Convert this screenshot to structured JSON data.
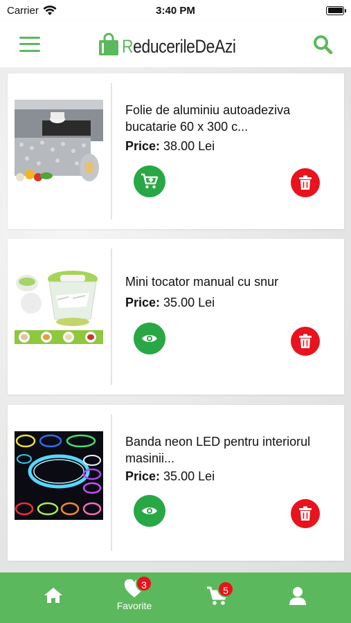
{
  "status_bar": {
    "carrier": "Carrier",
    "time": "3:40 PM"
  },
  "header": {
    "logo_letter": "R",
    "logo_text": "educerileDeAzi"
  },
  "products": [
    {
      "title": "Folie de aluminiu autoadeziva bucatarie 60 x 300 c...",
      "price_label": "Price:",
      "price_value": "38.00 Lei",
      "primary_action_icon": "cart-add-icon"
    },
    {
      "title": "Mini tocator manual cu snur",
      "price_label": "Price:",
      "price_value": "35.00 Lei",
      "primary_action_icon": "eye-icon"
    },
    {
      "title": "Banda neon LED pentru interiorul masinii...",
      "price_label": "Price:",
      "price_value": "35.00 Lei",
      "primary_action_icon": "eye-icon"
    }
  ],
  "bottom_nav": {
    "home": {
      "icon": "home-icon"
    },
    "favorite": {
      "icon": "heart-icon",
      "label": "Favorite",
      "badge": "3"
    },
    "cart": {
      "icon": "cart-icon",
      "badge": "5"
    },
    "profile": {
      "icon": "user-icon"
    }
  },
  "colors": {
    "accent": "#5cb85c",
    "action_green": "#28a745",
    "delete_red": "#e8131d"
  }
}
